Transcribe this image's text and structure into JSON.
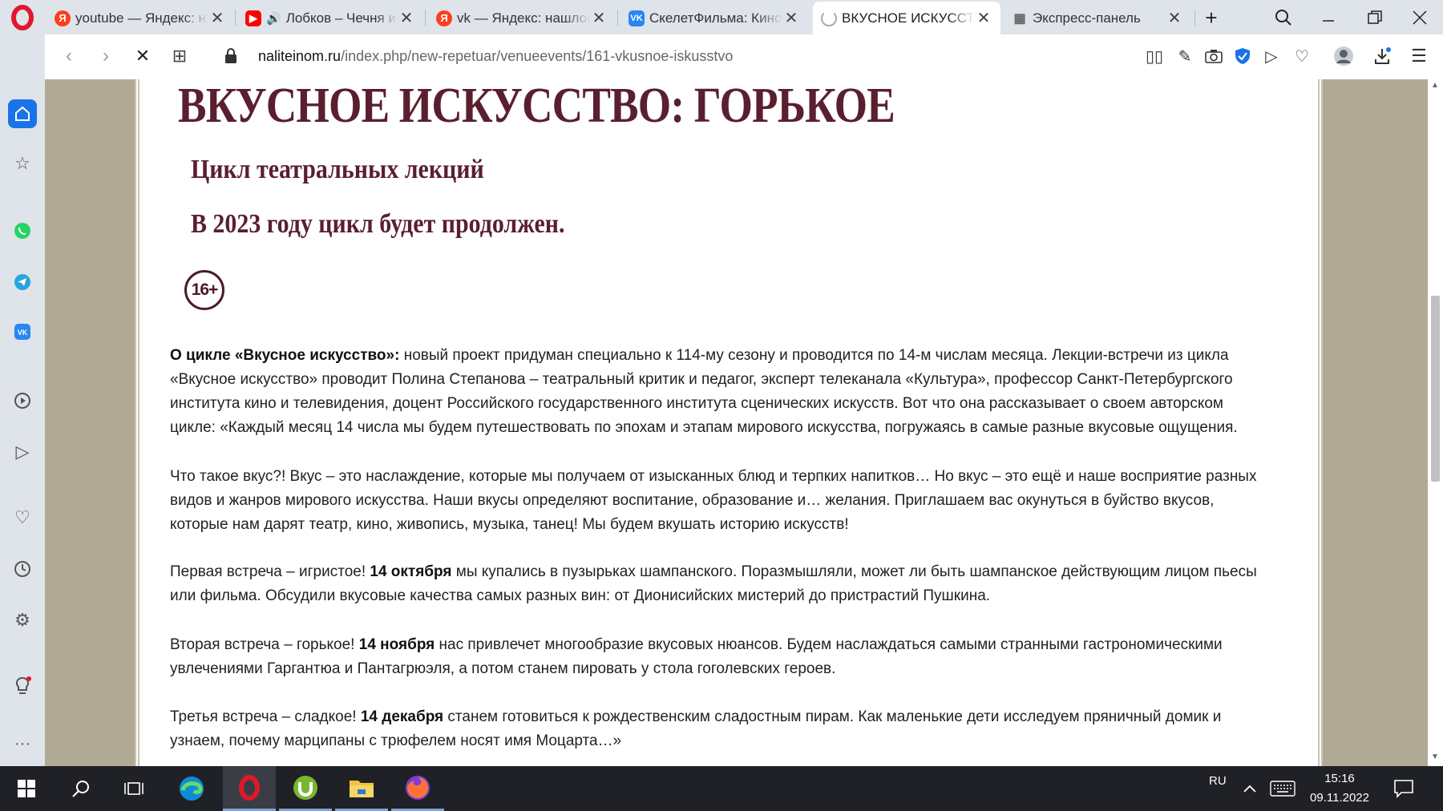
{
  "browser": {
    "tabs": [
      {
        "title": "youtube — Яндекс: н",
        "favicon": "yandex-icon",
        "color": "#f33"
      },
      {
        "title": "Лобков – Чечня и",
        "favicon": "youtube-icon",
        "color": "#f00"
      },
      {
        "title": "vk — Яндекс: нашлос",
        "favicon": "yandex-icon",
        "color": "#f33"
      },
      {
        "title": "СкелетФильма: Кино",
        "favicon": "vk-icon",
        "color": "#2787f5"
      },
      {
        "title": "ВКУСНОЕ ИСКУССТВО",
        "favicon": "loading-icon",
        "color": "#999"
      },
      {
        "title": "Экспресс-панель",
        "favicon": "grid-icon",
        "color": "#666"
      }
    ],
    "url": {
      "host": "naliteinom.ru",
      "path": "/index.php/new-repetuar/venueevents/161-vkusnoe-iskusstvo"
    }
  },
  "page": {
    "title": "ВКУСНОЕ ИСКУССТВО: ГОРЬКОЕ",
    "subtitle": "Цикл театральных лекций",
    "note": "В 2023 году цикл будет продолжен.",
    "age_rating": "16+",
    "p1_bold": "О цикле «Вкусное искусство»:",
    "p1_l1": " новый проект придуман специально к 114-му сезону и проводится по 14-м числам месяца. Лекции-встречи из цикла",
    "p1_l2": "«Вкусное искусство» проводит Полина Степанова – театральный критик и педагог, эксперт телеканала «Культура», профессор Санкт-Петербургского",
    "p1_l3": "института кино и телевидения, доцент Российского государственного института сценических искусств. Вот что она рассказывает о своем авторском",
    "p1_l4": "цикле: «Каждый месяц 14 числа мы будем путешествовать по эпохам и этапам мирового искусства, погружаясь в самые разные вкусовые ощущения.",
    "p2_l1": "Что такое вкус?! Вкус – это наслаждение, которые мы получаем от изысканных блюд и терпких напитков… Но вкус – это ещё и наше восприятие разных",
    "p2_l2": "видов и жанров мирового искусства. Наши вкусы определяют воспитание, образование и… желания. Приглашаем вас окунуться в буйство вкусов,",
    "p2_l3": "которые нам дарят театр, кино, живопись, музыка, танец! Мы будем вкушать историю искусств!",
    "p3_pre": "Первая встреча – игристое! ",
    "p3_bold": "14 октября",
    "p3_l1": " мы купались в пузырьках шампанского. Поразмышляли, может ли быть шампанское действующим лицом пьесы",
    "p3_l2": "или фильма. Обсудили вкусовые качества самых разных вин: от Дионисийских мистерий до пристрастий Пушкина.",
    "p4_pre": "Вторая встреча – горькое! ",
    "p4_bold": "14 ноября",
    "p4_l1": " нас привлечет многообразие вкусовых нюансов. Будем наслаждаться самыми странными гастрономическими",
    "p4_l2": "увлечениями Гаргантюа и Пантагрюэля, а потом станем пировать у стола гоголевских героев.",
    "p5_pre": "Третья встреча – сладкое! ",
    "p5_bold": "14 декабря",
    "p5_l1": " станем готовиться к рождественским сладостным пирам. Как маленькие дети исследуем пряничный домик и",
    "p5_l2": "узнаем, почему марципаны с трюфелем носят имя Моцарта…»"
  },
  "taskbar": {
    "language": "RU",
    "time": "15:16",
    "date": "09.11.2022"
  },
  "colors": {
    "title": "#5a1f2f",
    "page_bg": "#b1aa95",
    "accent": "#1a73e8"
  }
}
